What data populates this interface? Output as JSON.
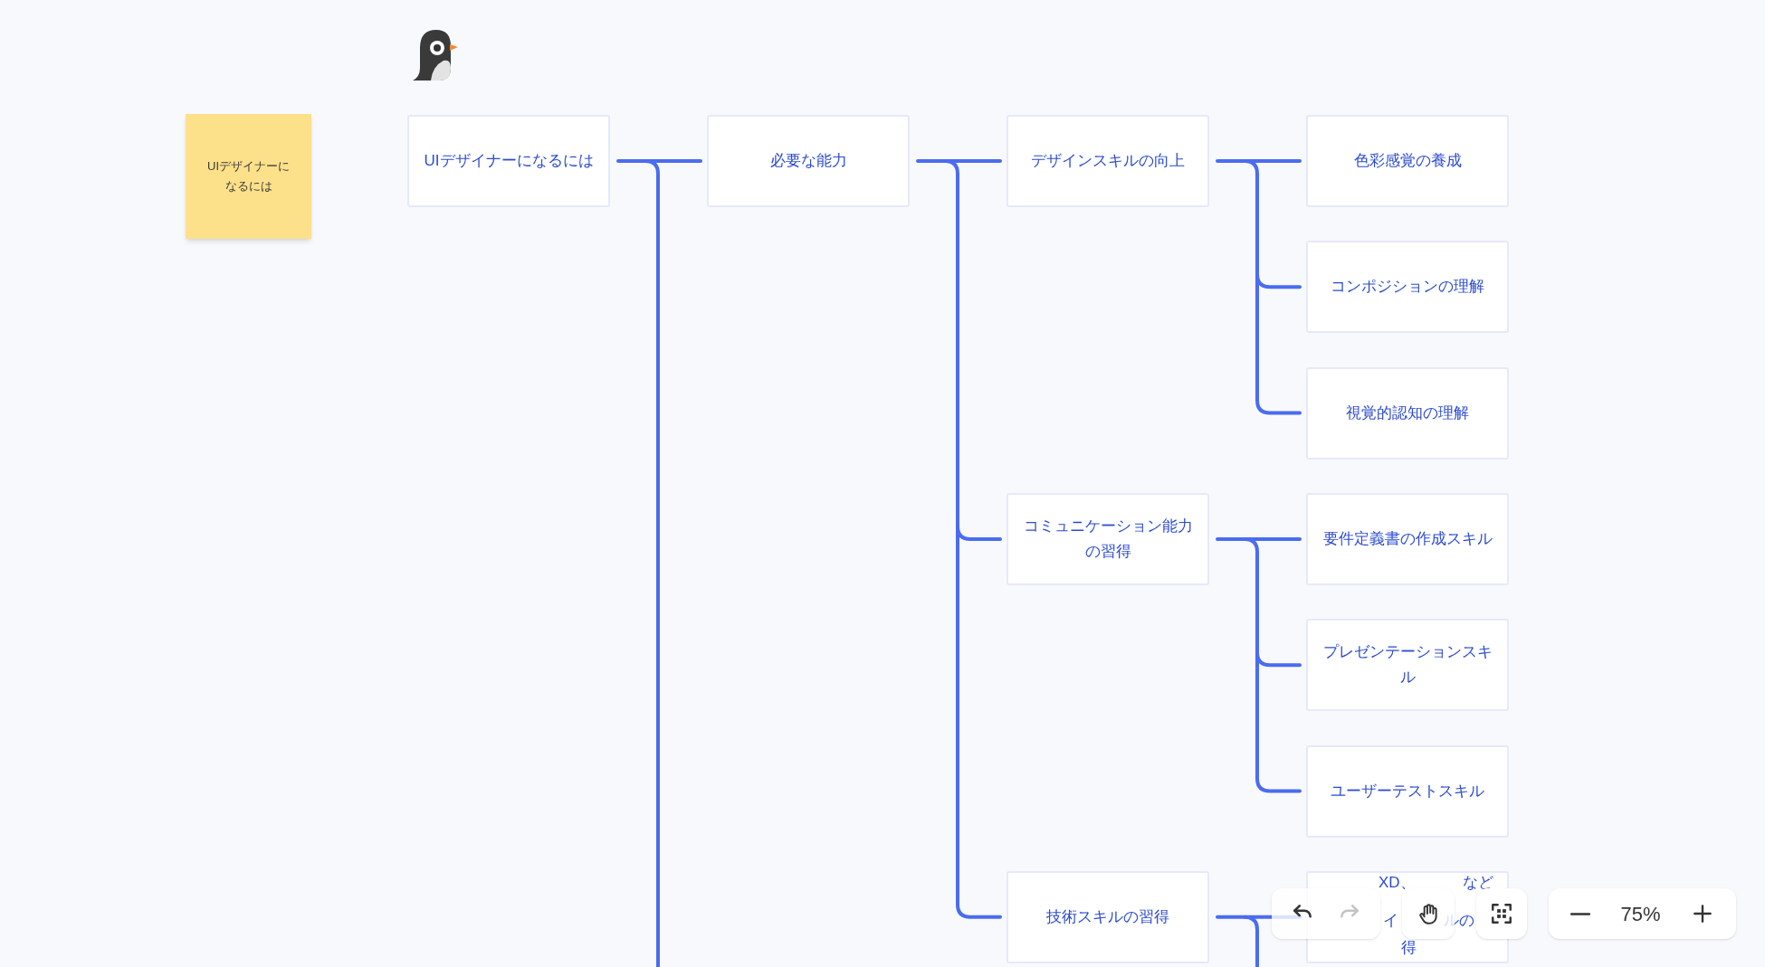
{
  "sticky_note": {
    "text": "UIデザイナーになるには"
  },
  "mindmap": {
    "root": {
      "text": "UIデザイナーになるには",
      "continues_below": true,
      "children": [
        {
          "text": "必要な能力",
          "continues_below": false,
          "children": [
            {
              "text": "デザインスキルの向上",
              "continues_below": false,
              "children": [
                {
                  "text": "色彩感覚の養成"
                },
                {
                  "text": "コンポジションの理解"
                },
                {
                  "text": "視覚的認知の理解"
                }
              ]
            },
            {
              "text": "コミュニケーション能力の習得",
              "continues_below": false,
              "children": [
                {
                  "text": "要件定義書の作成スキル"
                },
                {
                  "text": "プレゼンテーションスキル"
                },
                {
                  "text": "ユーザーテストスキル"
                }
              ]
            },
            {
              "text": "技術スキルの習得",
              "continues_below": true,
              "children": [
                {
                  "kind": "partial",
                  "fragments": [
                    "XD、",
                    "など",
                    "イ",
                    "ルの",
                    "得"
                  ]
                }
              ]
            }
          ]
        }
      ]
    }
  },
  "toolbar": {
    "undo": {
      "disabled": false
    },
    "redo": {
      "disabled": true
    },
    "zoom_level": "75%"
  }
}
